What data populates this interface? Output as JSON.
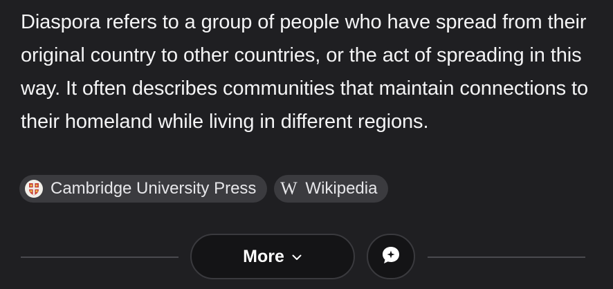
{
  "answer": {
    "text": "Diaspora refers to a group of people who have spread from their original country to other countries, or the act of spreading in this way. It often describes communities that maintain connections to their homeland while living in different regions."
  },
  "sources": [
    {
      "label": "Cambridge University Press",
      "icon": "cambridge-crest-icon"
    },
    {
      "label": "Wikipedia",
      "icon": "wikipedia-icon",
      "glyph": "W"
    }
  ],
  "footer": {
    "more_label": "More",
    "more_icon": "chevron-down-icon",
    "chat_icon": "chat-sparkle-icon"
  },
  "colors": {
    "background": "#1f1f22",
    "chip_background": "#3b3b3f",
    "button_background": "#141416",
    "divider": "#4a4a4f",
    "cambridge_red": "#c8433a"
  }
}
